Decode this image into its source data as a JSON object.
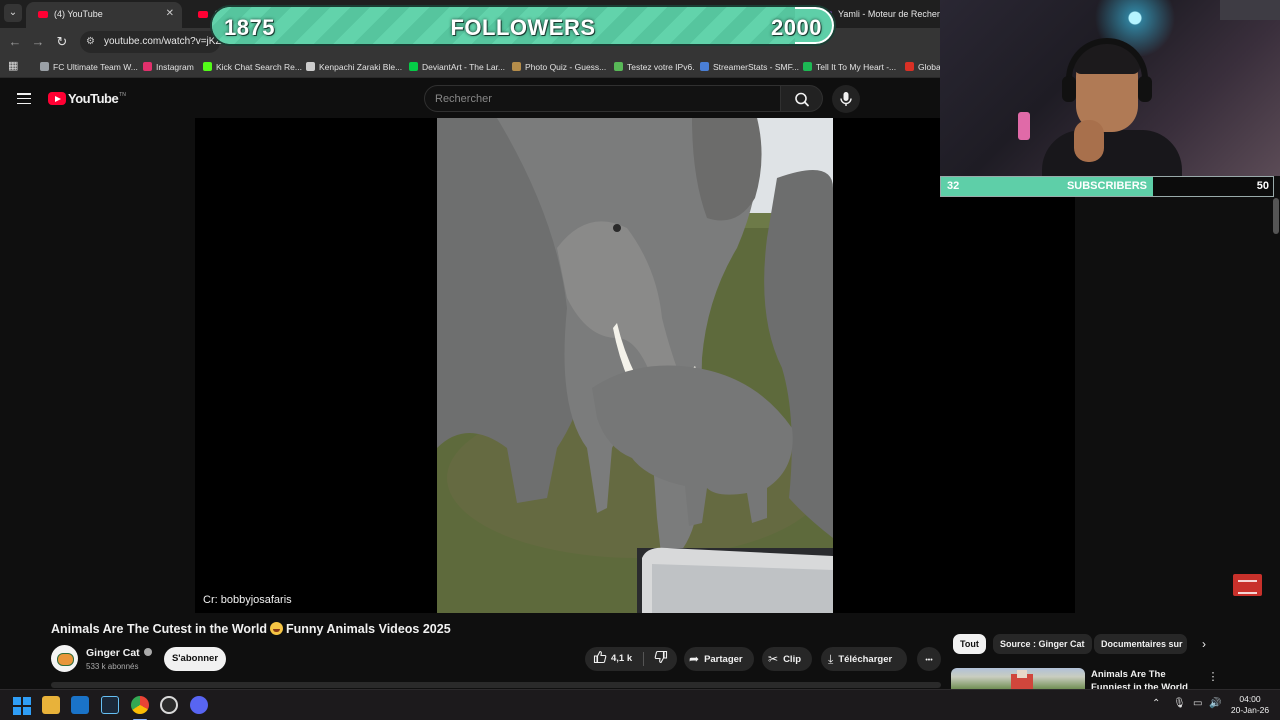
{
  "browser": {
    "tabs": [
      {
        "label": "(4) YouTube",
        "active": true
      },
      {
        "label": "(4",
        "active": false
      },
      {
        "label": "Yamli - Moteur de Recherche",
        "active": false
      }
    ],
    "tab_close_glyph": "✕",
    "url": "youtube.com/watch?v=jKZ",
    "bookmarks": [
      {
        "label": "FC Ultimate Team W...",
        "color": "#9aa0a6"
      },
      {
        "label": "Instagram",
        "color": "#e1306c"
      },
      {
        "label": "Kick Chat Search Re...",
        "color": "#53fc18"
      },
      {
        "label": "Kenpachi Zaraki Ble...",
        "color": "#cccccc"
      },
      {
        "label": "DeviantArt - The Lar...",
        "color": "#05cc47"
      },
      {
        "label": "Photo Quiz - Guess...",
        "color": "#b58d4a"
      },
      {
        "label": "Testez votre IPv6.",
        "color": "#58b857"
      },
      {
        "label": "StreamerStats - SMF...",
        "color": "#4a7fd6"
      },
      {
        "label": "Tell It To My Heart -...",
        "color": "#1db954"
      },
      {
        "label": "Globa",
        "color": "#d93025"
      }
    ]
  },
  "youtube": {
    "logo_text": "YouTube",
    "logo_suffix": "TN",
    "search_placeholder": "Rechercher",
    "video": {
      "credit": "Cr: bobbyjosafaris",
      "title_part1": "Animals Are The Cutest in the World",
      "title_part2": "Funny Animals Videos 2025",
      "channel": "Ginger Cat",
      "subscribers": "533 k abonnés",
      "subscribe_label": "S'abonner",
      "likes": "4,1 k",
      "share_label": "Partager",
      "clip_label": "Clip",
      "download_label": "Télécharger",
      "more_glyph": "•••"
    },
    "chips": [
      {
        "label": "Tout",
        "active": true
      },
      {
        "label": "Source : Ginger Cat",
        "active": false
      },
      {
        "label": "Documentaires sur",
        "active": false
      }
    ],
    "suggestion": {
      "title": "Animals Are The Funniest in the World 🤣 Funny"
    }
  },
  "overlay": {
    "followers": {
      "current": "1875",
      "label": "FOLLOWERS",
      "goal": "2000",
      "progress": 0.9375
    },
    "subscribers": {
      "current": "32",
      "label": "SUBSCRIBERS",
      "goal": "50",
      "progress": 0.64
    }
  },
  "taskbar": {
    "time": "04:00",
    "date": "20-Jan-26",
    "icons": [
      "windows-start",
      "file-explorer",
      "outlook",
      "steam",
      "chrome",
      "obs",
      "discord"
    ]
  },
  "colors": {
    "youtube_red": "#ff0033",
    "overlay_green": "#5ecfa8",
    "windows_blue": "#2f9ef6"
  }
}
